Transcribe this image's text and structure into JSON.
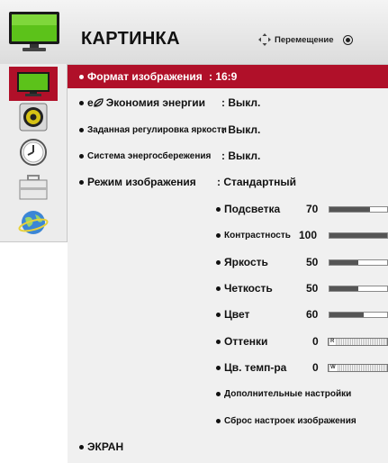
{
  "header": {
    "title": "КАРТИНКА",
    "hint_label": "Перемещение",
    "tv_icon": "tv-icon",
    "nav_icon": "four-way-arrows-icon",
    "ok_icon": "ok-button-icon"
  },
  "sidebar": {
    "items": [
      {
        "icon": "picture-tv-icon",
        "active": true
      },
      {
        "icon": "speaker-icon",
        "active": false
      },
      {
        "icon": "clock-icon",
        "active": false
      },
      {
        "icon": "toolbox-icon",
        "active": false
      },
      {
        "icon": "globe-network-icon",
        "active": false
      }
    ]
  },
  "menu": {
    "items": [
      {
        "label": "Формат изображения",
        "value": ": 16:9",
        "selected": true
      },
      {
        "label": "Экономия энергии",
        "value": ": Выкл.",
        "icon": "eco-leaf-icon",
        "icon_text": "e"
      },
      {
        "label": "Заданная регулировка яркости",
        "value": ": Выкл."
      },
      {
        "label": "Система энергосбережения",
        "value": ": Выкл."
      },
      {
        "label": "Режим изображения",
        "value": ": Стандартный"
      }
    ],
    "sub_items": [
      {
        "label": "Подсветка",
        "value": "70",
        "level": 70
      },
      {
        "label": "Контрастность",
        "value": "100",
        "level": 100
      },
      {
        "label": "Яркость",
        "value": "50",
        "level": 50
      },
      {
        "label": "Четкость",
        "value": "50",
        "level": 50
      },
      {
        "label": "Цвет",
        "value": "60",
        "level": 60
      },
      {
        "label": "Оттенки",
        "value": "0",
        "bar_tag": "R"
      },
      {
        "label": "Цв. темп-ра",
        "value": "0",
        "bar_tag": "W"
      }
    ],
    "extra_items": [
      {
        "label": "Дополнительные настройки"
      },
      {
        "label": "Сброс настроек изображения"
      }
    ],
    "screen_item": {
      "label": "ЭКРАН"
    }
  },
  "colors": {
    "accent": "#b01029",
    "panel_bg": "#f0f0f0",
    "bar_fill": "#555555"
  }
}
